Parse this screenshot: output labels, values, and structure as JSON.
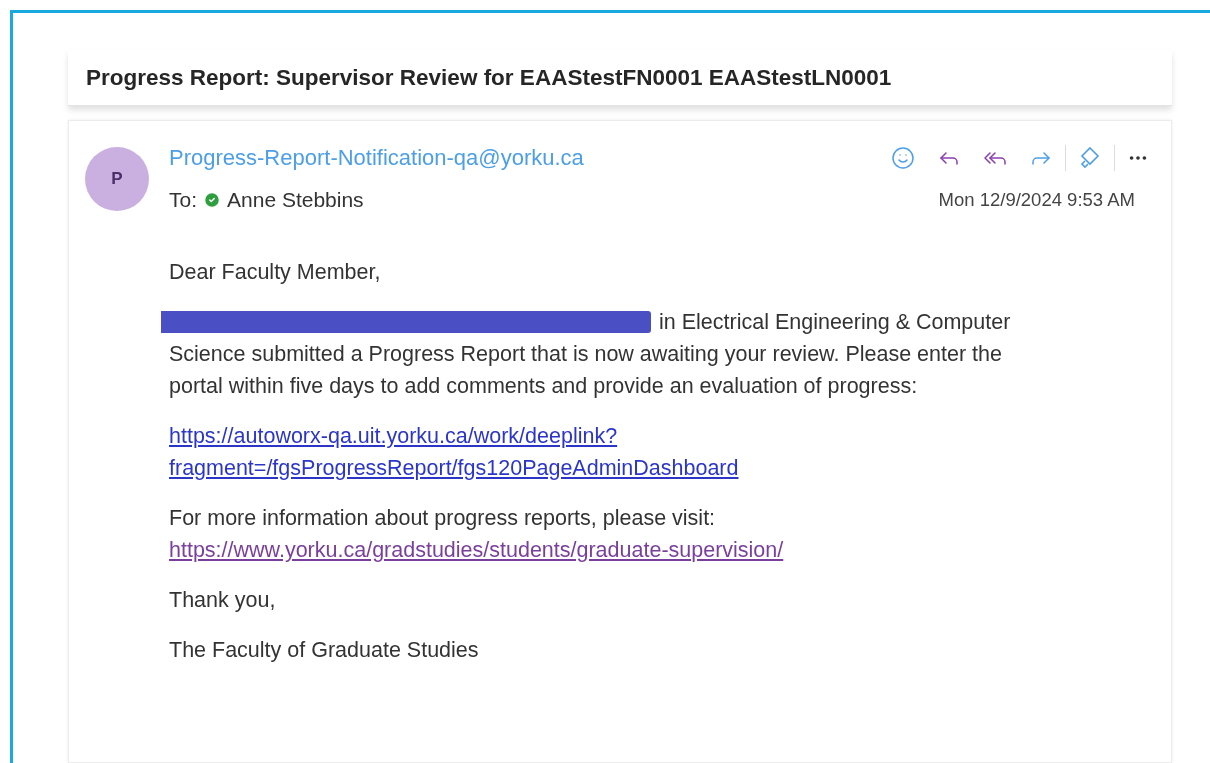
{
  "subject": "Progress Report: Supervisor Review for EAAStestFN0001 EAAStestLN0001",
  "message": {
    "avatar": "P",
    "sender": "Progress-Report-Notification-qa@yorku.ca",
    "to_label": "To:",
    "recipient": "Anne Stebbins",
    "date": "Mon 12/9/2024 9:53 AM"
  },
  "body": {
    "greeting": "Dear Faculty Member,",
    "intro_first_line": "in Electrical Engineering & Computer",
    "intro_rest": "Science submitted a Progress Report that is now awaiting your review. Please enter the portal within five days to add comments and provide an evaluation of progress:",
    "portal_link": {
      "lines": [
        "https://autoworx-qa.uit.yorku.ca/work/deeplink?",
        "fragment=/fgsProgressReport/fgs120PageAdminDashboard"
      ],
      "visited": false
    },
    "info": "For more information about progress reports, please visit:",
    "info_link": {
      "lines": [
        "https://www.yorku.ca/gradstudies/students/graduate-supervision/"
      ],
      "visited": true
    },
    "thanks": "Thank you,",
    "signature": "The Faculty of Graduate Studies"
  }
}
